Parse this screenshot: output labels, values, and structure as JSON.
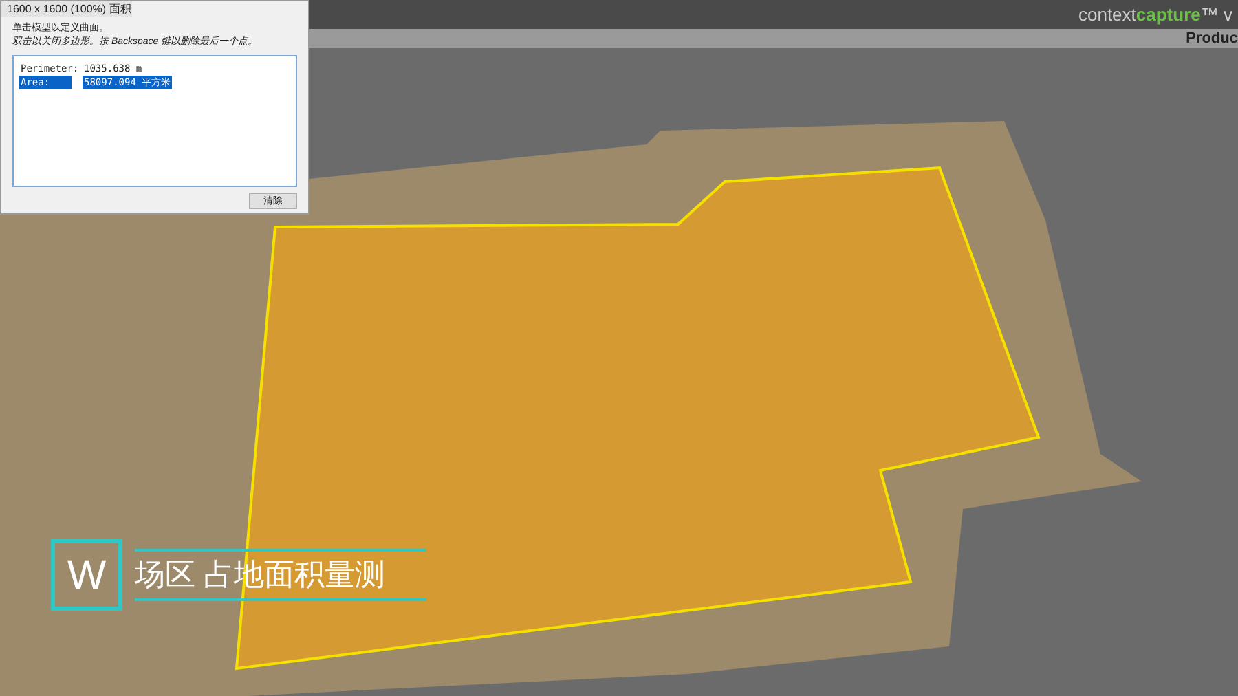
{
  "app_header": {
    "brand_prefix": "context",
    "brand_highlight": "capture",
    "brand_suffix": "™ v",
    "tab_label": "Produc"
  },
  "measure_dialog": {
    "title": "1600 x 1600 (100%) 面积",
    "instructions": [
      "单击模型以定义曲面。",
      "双击以关闭多边形。按 Backspace 键以删除最后一个点。"
    ],
    "results": [
      {
        "label": "Perimeter:",
        "value": "1035.638 m",
        "selected": false
      },
      {
        "label": "Area:",
        "value": "58097.094 平方米",
        "selected": true
      }
    ],
    "clear_button": "清除"
  },
  "caption": {
    "letter": "W",
    "title": "场区 占地面积量测"
  }
}
